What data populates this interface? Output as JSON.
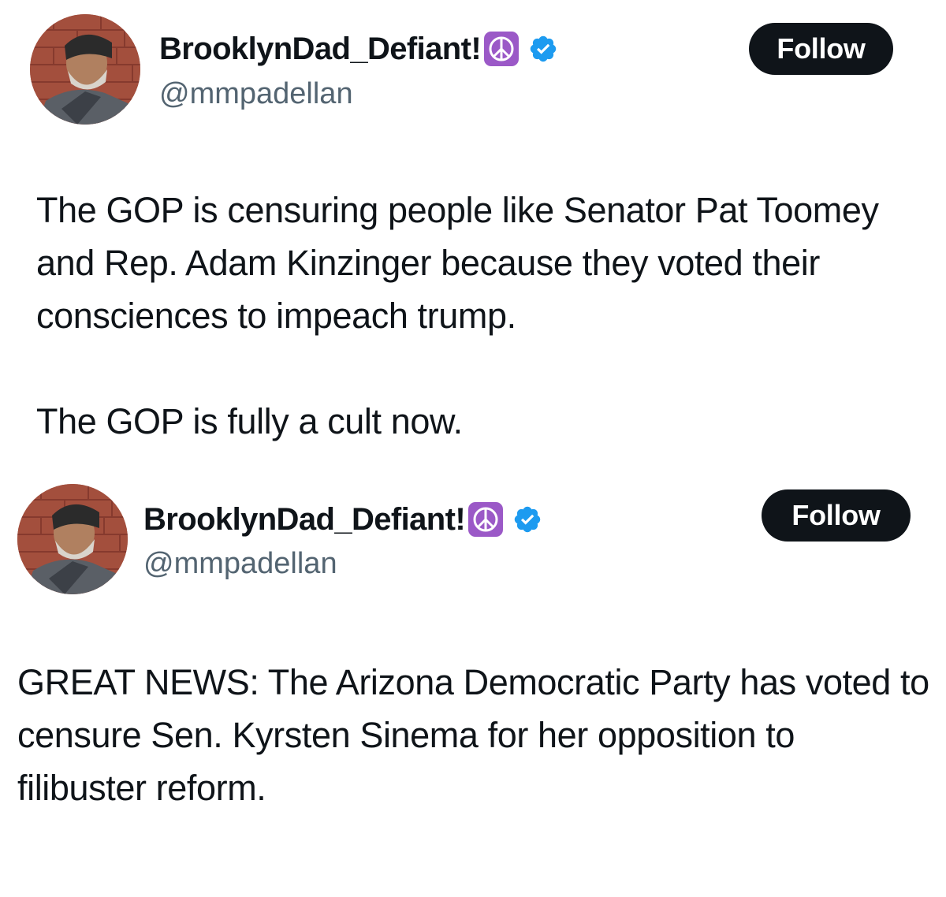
{
  "tweets": [
    {
      "display_name": "BrooklynDad_Defiant!",
      "handle": "@mmpadellan",
      "follow_label": "Follow",
      "icons": [
        "peace-symbol-icon",
        "verified-badge-icon"
      ],
      "paragraphs": [
        "The GOP is censuring people like Senator Pat Toomey and Rep. Adam Kinzinger because they voted their consciences to impeach trump.",
        "The GOP is fully a cult now."
      ]
    },
    {
      "display_name": "BrooklynDad_Defiant!",
      "handle": "@mmpadellan",
      "follow_label": "Follow",
      "icons": [
        "peace-symbol-icon",
        "verified-badge-icon"
      ],
      "paragraphs": [
        "GREAT NEWS: The Arizona Democratic Party has voted to censure Sen. Kyrsten Sinema for her opposition to filibuster reform."
      ]
    }
  ],
  "colors": {
    "text": "#0f1419",
    "handle": "#536471",
    "follow_bg": "#0f1419",
    "follow_text": "#ffffff",
    "verified": "#1d9bf0",
    "peace_bg": "#9b59c7"
  }
}
